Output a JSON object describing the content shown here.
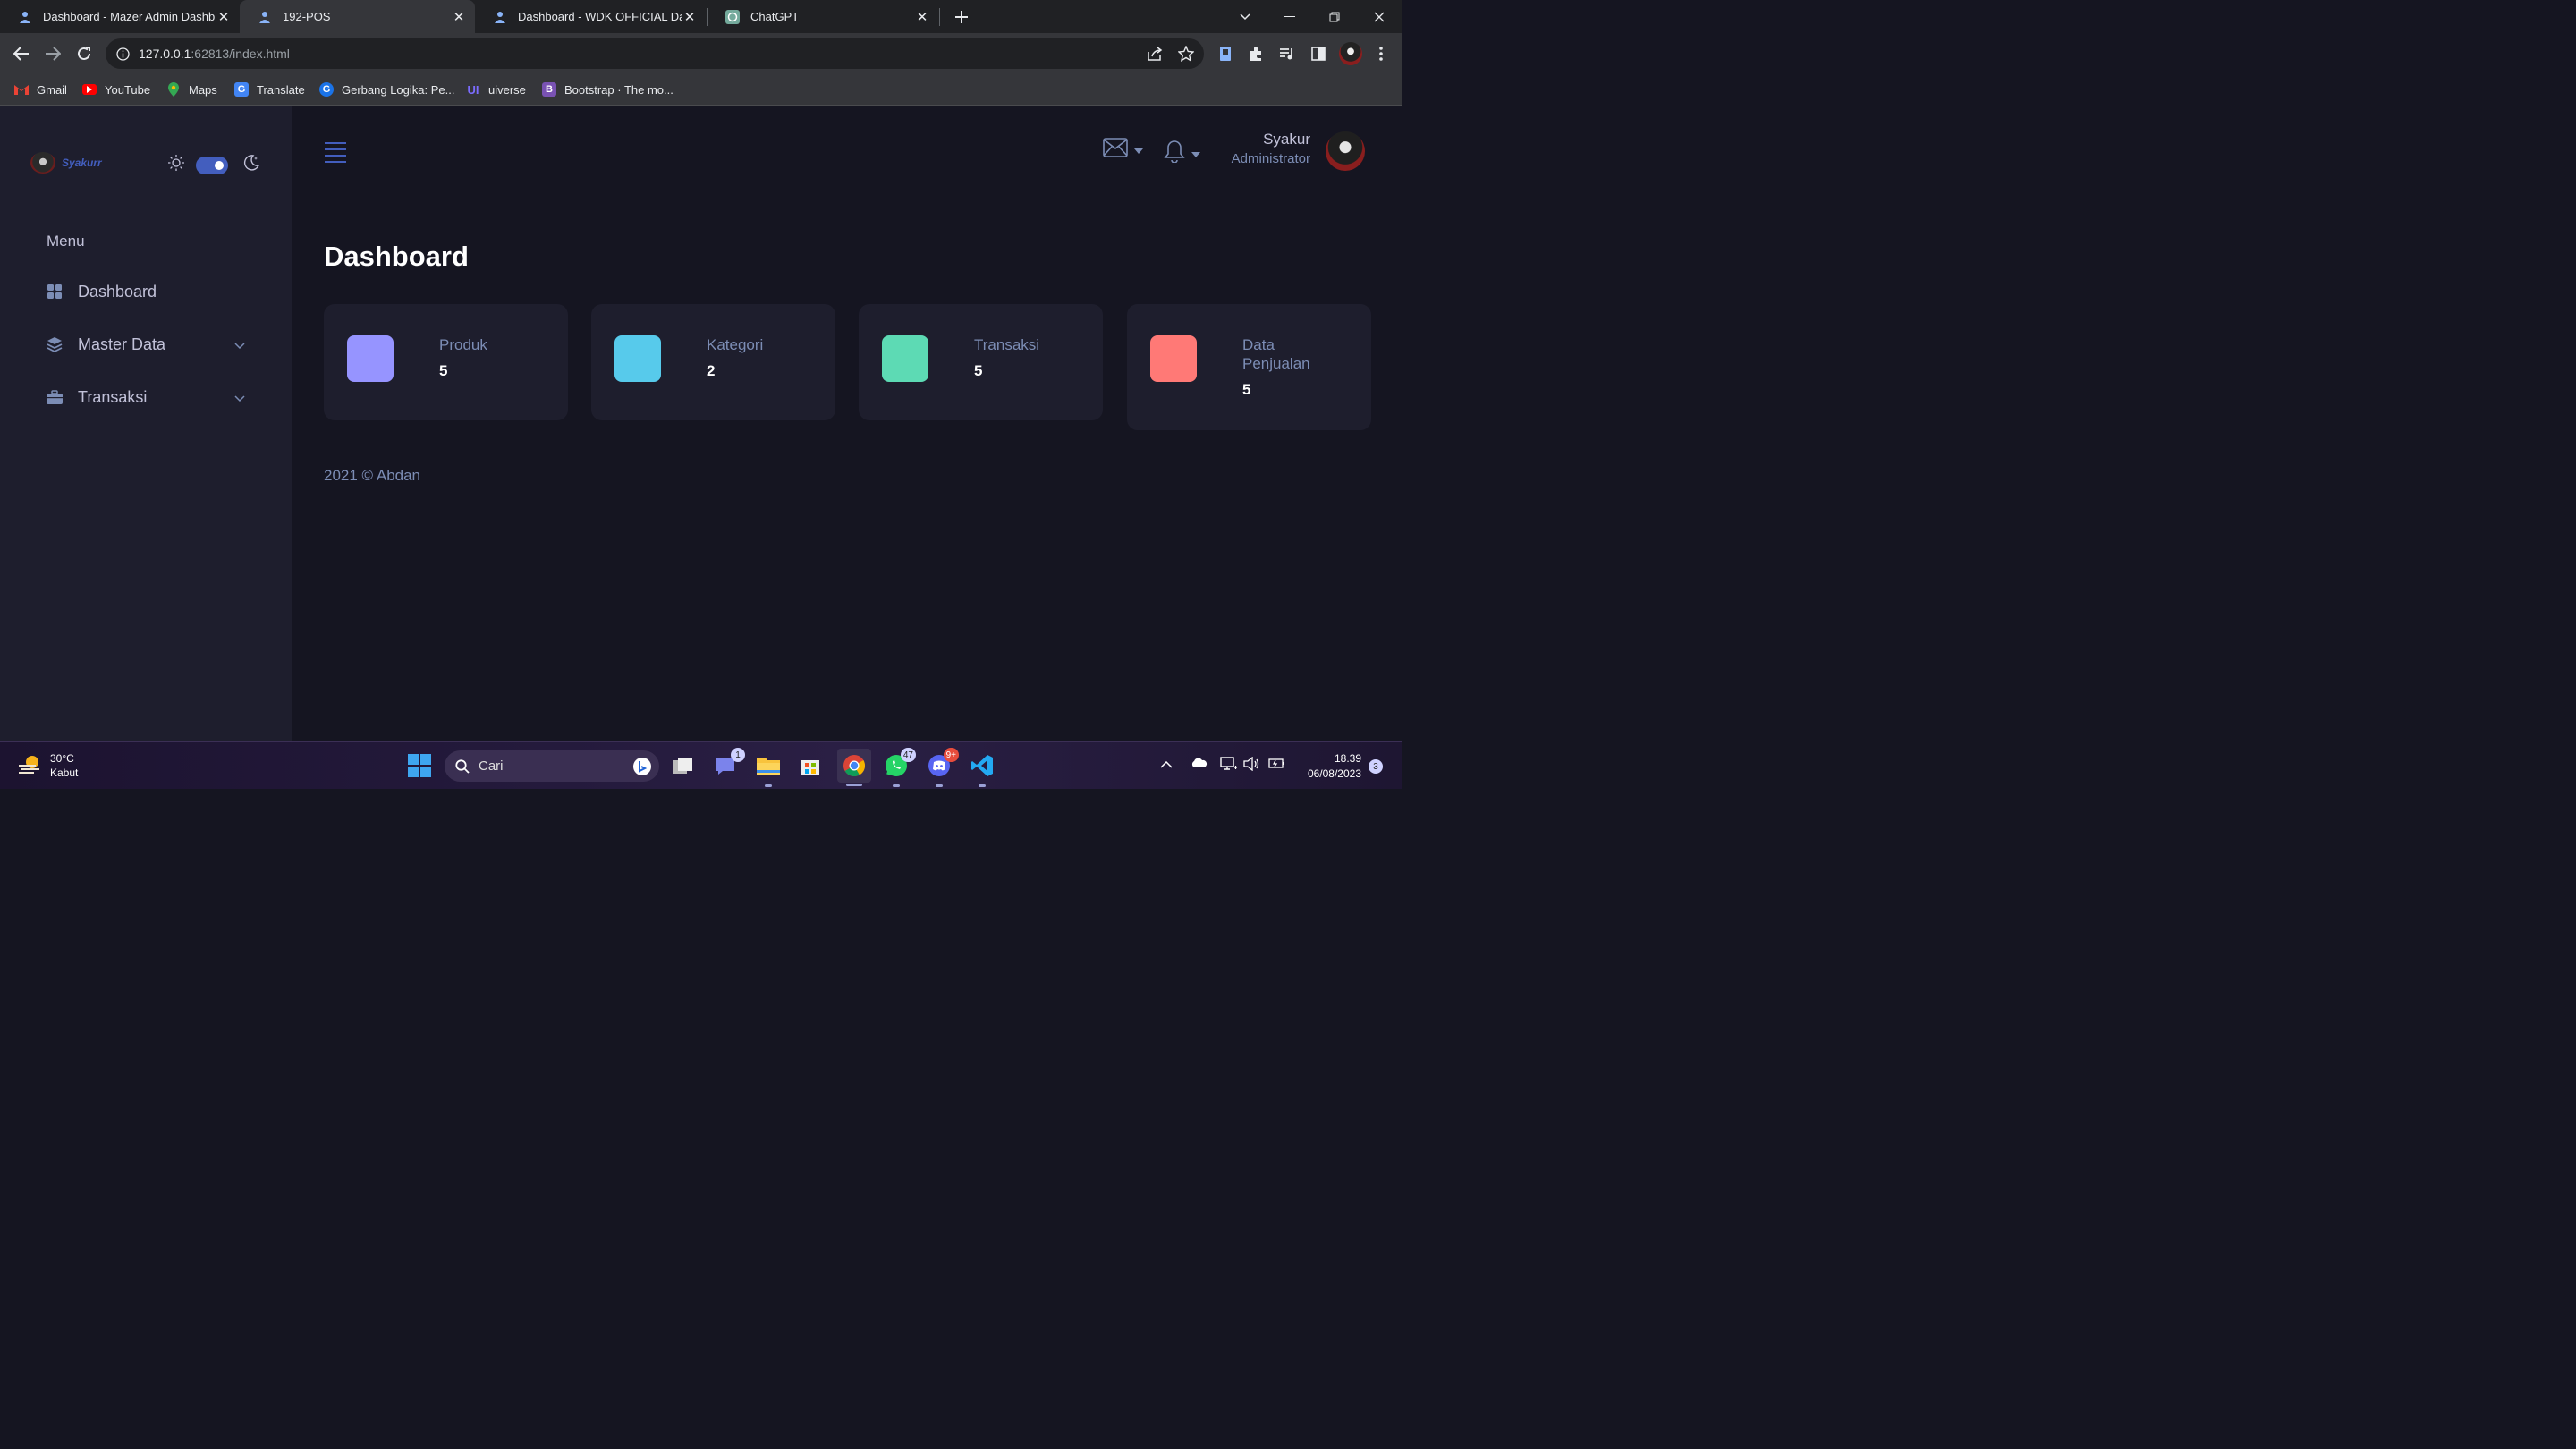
{
  "browser": {
    "tabs": [
      {
        "title": "Dashboard - Mazer Admin Dashb"
      },
      {
        "title": "192-POS"
      },
      {
        "title": "Dashboard - WDK OFFICIAL Dash"
      },
      {
        "title": "ChatGPT"
      }
    ],
    "url_host": "127.0.0.1",
    "url_path": ":62813/index.html",
    "bookmarks": [
      "Gmail",
      "YouTube",
      "Maps",
      "Translate",
      "Gerbang Logika: Pe...",
      "uiverse",
      "Bootstrap · The mo..."
    ]
  },
  "sidebar": {
    "brand": "Syakurr",
    "menu_title": "Menu",
    "items": [
      {
        "label": "Dashboard",
        "icon": "grid-icon"
      },
      {
        "label": "Master Data",
        "icon": "stack-icon"
      },
      {
        "label": "Transaksi",
        "icon": "briefcase-icon"
      }
    ]
  },
  "header": {
    "user_name": "Syakur",
    "user_role": "Administrator"
  },
  "page": {
    "title": "Dashboard",
    "cards": [
      {
        "label": "Produk",
        "value": "5",
        "color": "#9694ff"
      },
      {
        "label": "Kategori",
        "value": "2",
        "color": "#57caeb"
      },
      {
        "label": "Transaksi",
        "value": "5",
        "color": "#5ddab4"
      },
      {
        "label": "Data Penjualan",
        "value": "5",
        "color": "#ff7976"
      }
    ],
    "footer": "2021 © Abdan"
  },
  "taskbar": {
    "temp": "30°C",
    "weather": "Kabut",
    "search_placeholder": "Cari",
    "badge_teams": "1",
    "badge_whatsapp": "47",
    "badge_discord": "9+",
    "time": "18.39",
    "date": "06/08/2023",
    "notifications": "3"
  },
  "colors": {
    "accent": "#435ebe",
    "sidebar_bg": "#1e1e2d",
    "main_bg": "#151521"
  }
}
